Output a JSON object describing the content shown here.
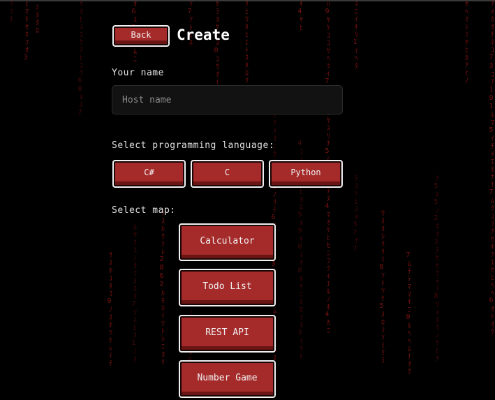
{
  "header": {
    "back_label": "Back",
    "title": "Create"
  },
  "name_field": {
    "label": "Your name",
    "placeholder": "Host name",
    "value": ""
  },
  "language": {
    "label": "Select programming language:",
    "options": [
      "C#",
      "C",
      "Python"
    ]
  },
  "map": {
    "label": "Select map:",
    "options": [
      "Calculator",
      "Todo List",
      "REST API",
      "Number Game"
    ]
  },
  "colors": {
    "background": "#000000",
    "button": "#a52a2a",
    "rain": "#a11818"
  }
}
